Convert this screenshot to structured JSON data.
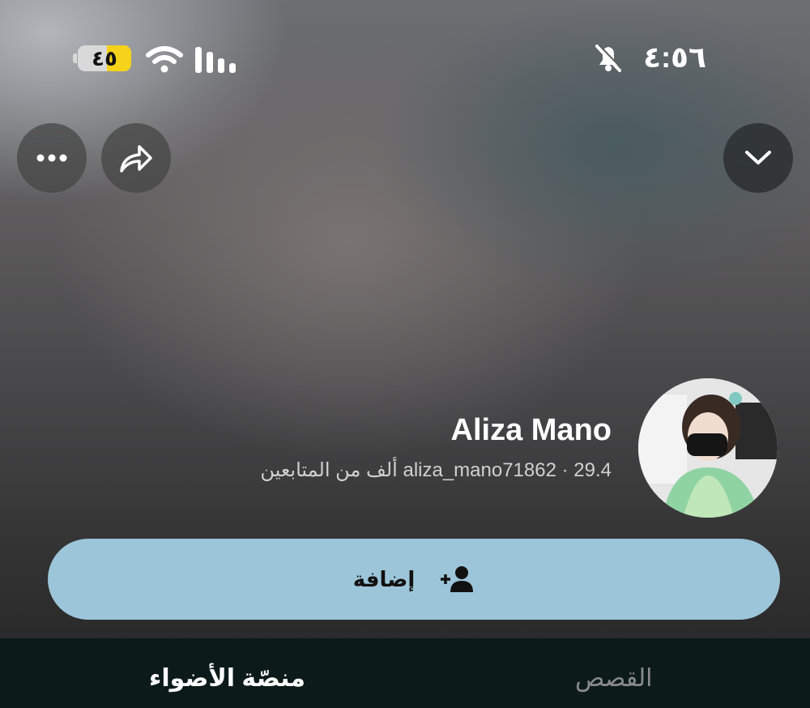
{
  "status_bar": {
    "time": "٤:٥٦",
    "battery": "٤٥",
    "icons": [
      "bell-slash-icon",
      "wifi-icon",
      "signal-icon",
      "battery-icon"
    ]
  },
  "top_actions": {
    "more_icon": "ellipsis-icon",
    "share_icon": "share-arrow-icon",
    "collapse_icon": "chevron-down-icon"
  },
  "profile": {
    "display_name": "Aliza Mano",
    "subtitle": "aliza_mano71862 · 29.4 ألف من المتابعين"
  },
  "add_button": {
    "label": "إضافة",
    "icon": "add-friend-icon"
  },
  "tabs": [
    {
      "label": "منصّة الأضواء",
      "active": true
    },
    {
      "label": "القصص",
      "active": false
    }
  ],
  "colors": {
    "accent": "#9cc5d9",
    "battery_fill": "#f7d21a",
    "tabbar": "#0c1a1a"
  }
}
